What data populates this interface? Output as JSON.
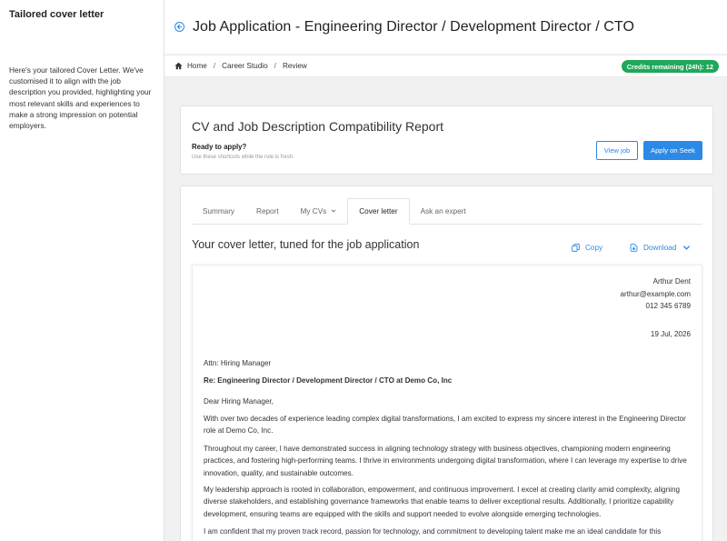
{
  "sidebar": {
    "title": "Tailored cover letter",
    "description": "Here's your tailored Cover Letter. We've customised it to align with the job description you provided, highlighting your most relevant skills and experiences to make a strong impression on potential employers."
  },
  "header": {
    "title": "Job Application - Engineering Director / Development Director / CTO"
  },
  "breadcrumb": {
    "items": [
      "Home",
      "Career Studio",
      "Review"
    ],
    "separator": "/"
  },
  "credits": {
    "label": "Credits remaining (24h): 12"
  },
  "report": {
    "title": "CV and Job Description Compatibility Report",
    "ready_label": "Ready to apply?",
    "ready_sub": "Use these shortcuts while the role is fresh.",
    "view_job_label": "View job",
    "apply_label": "Apply on Seek"
  },
  "tabs": [
    {
      "label": "Summary"
    },
    {
      "label": "Report"
    },
    {
      "label": "My CVs"
    },
    {
      "label": "Cover letter"
    },
    {
      "label": "Ask an expert"
    }
  ],
  "cover_letter": {
    "heading": "Your cover letter, tuned for the job application",
    "copy_label": "Copy",
    "download_label": "Download",
    "sender_name": "Arthur Dent",
    "sender_email": "arthur@example.com",
    "sender_phone": "012 345 6789",
    "date": "19 Jul, 2026",
    "attn": "Attn: Hiring Manager",
    "re": "Re: Engineering Director / Development Director / CTO at Demo Co, Inc",
    "greeting": "Dear Hiring Manager,",
    "paragraphs": [
      "With over two decades of experience leading complex digital transformations, I am excited to express my sincere interest in the Engineering Director role at Demo Co, Inc.",
      "Throughout my career, I have demonstrated success in aligning technology strategy with business objectives, championing modern engineering practices, and fostering high-performing teams. I thrive in environments undergoing digital transformation, where I can leverage my expertise to drive innovation, quality, and sustainable outcomes.",
      "My leadership approach is rooted in collaboration, empowerment, and continuous improvement. I excel at creating clarity amid complexity, aligning diverse stakeholders, and establishing governance frameworks that enable teams to deliver exceptional results. Additionally, I prioritize capability development, ensuring teams are equipped with the skills and support needed to evolve alongside emerging technologies.",
      "I am confident that my proven track record, passion for technology, and commitment to developing talent make me an ideal candidate for this"
    ]
  },
  "colors": {
    "accent": "#2b8ae6",
    "credits_badge": "#1fa85a"
  }
}
